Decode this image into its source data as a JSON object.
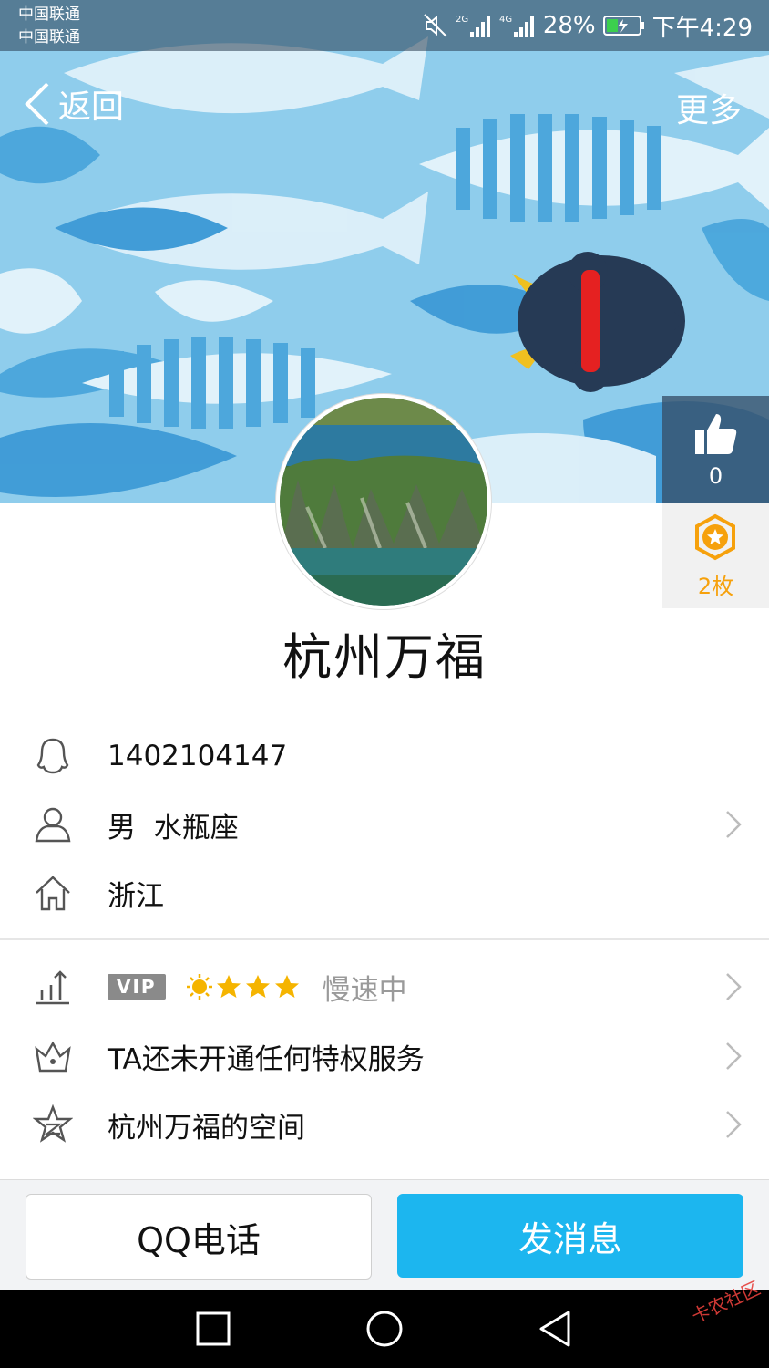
{
  "status_bar": {
    "carrier_1": "中国联通",
    "carrier_2": "中国联通",
    "network_1": "2G",
    "network_2": "4G",
    "battery": "28%",
    "time": "下午4:29"
  },
  "header": {
    "back_label": "返回",
    "more_label": "更多"
  },
  "side": {
    "like_count": "0",
    "badge_count": "2枚"
  },
  "profile": {
    "nickname": "杭州万福",
    "qq_number": "1402104147",
    "gender_sign": "男  水瓶座",
    "location": "浙江",
    "vip_tag": "VIP",
    "vip_status": "慢速中",
    "privilege": "TA还未开通任何特权服务",
    "space": "杭州万福的空间"
  },
  "actions": {
    "call_label": "QQ电话",
    "message_label": "发消息"
  },
  "watermark": "卡农社区",
  "colors": {
    "accent": "#1cb6ef",
    "cover_bg": "#8ccbea",
    "badge": "#f6a10c"
  }
}
